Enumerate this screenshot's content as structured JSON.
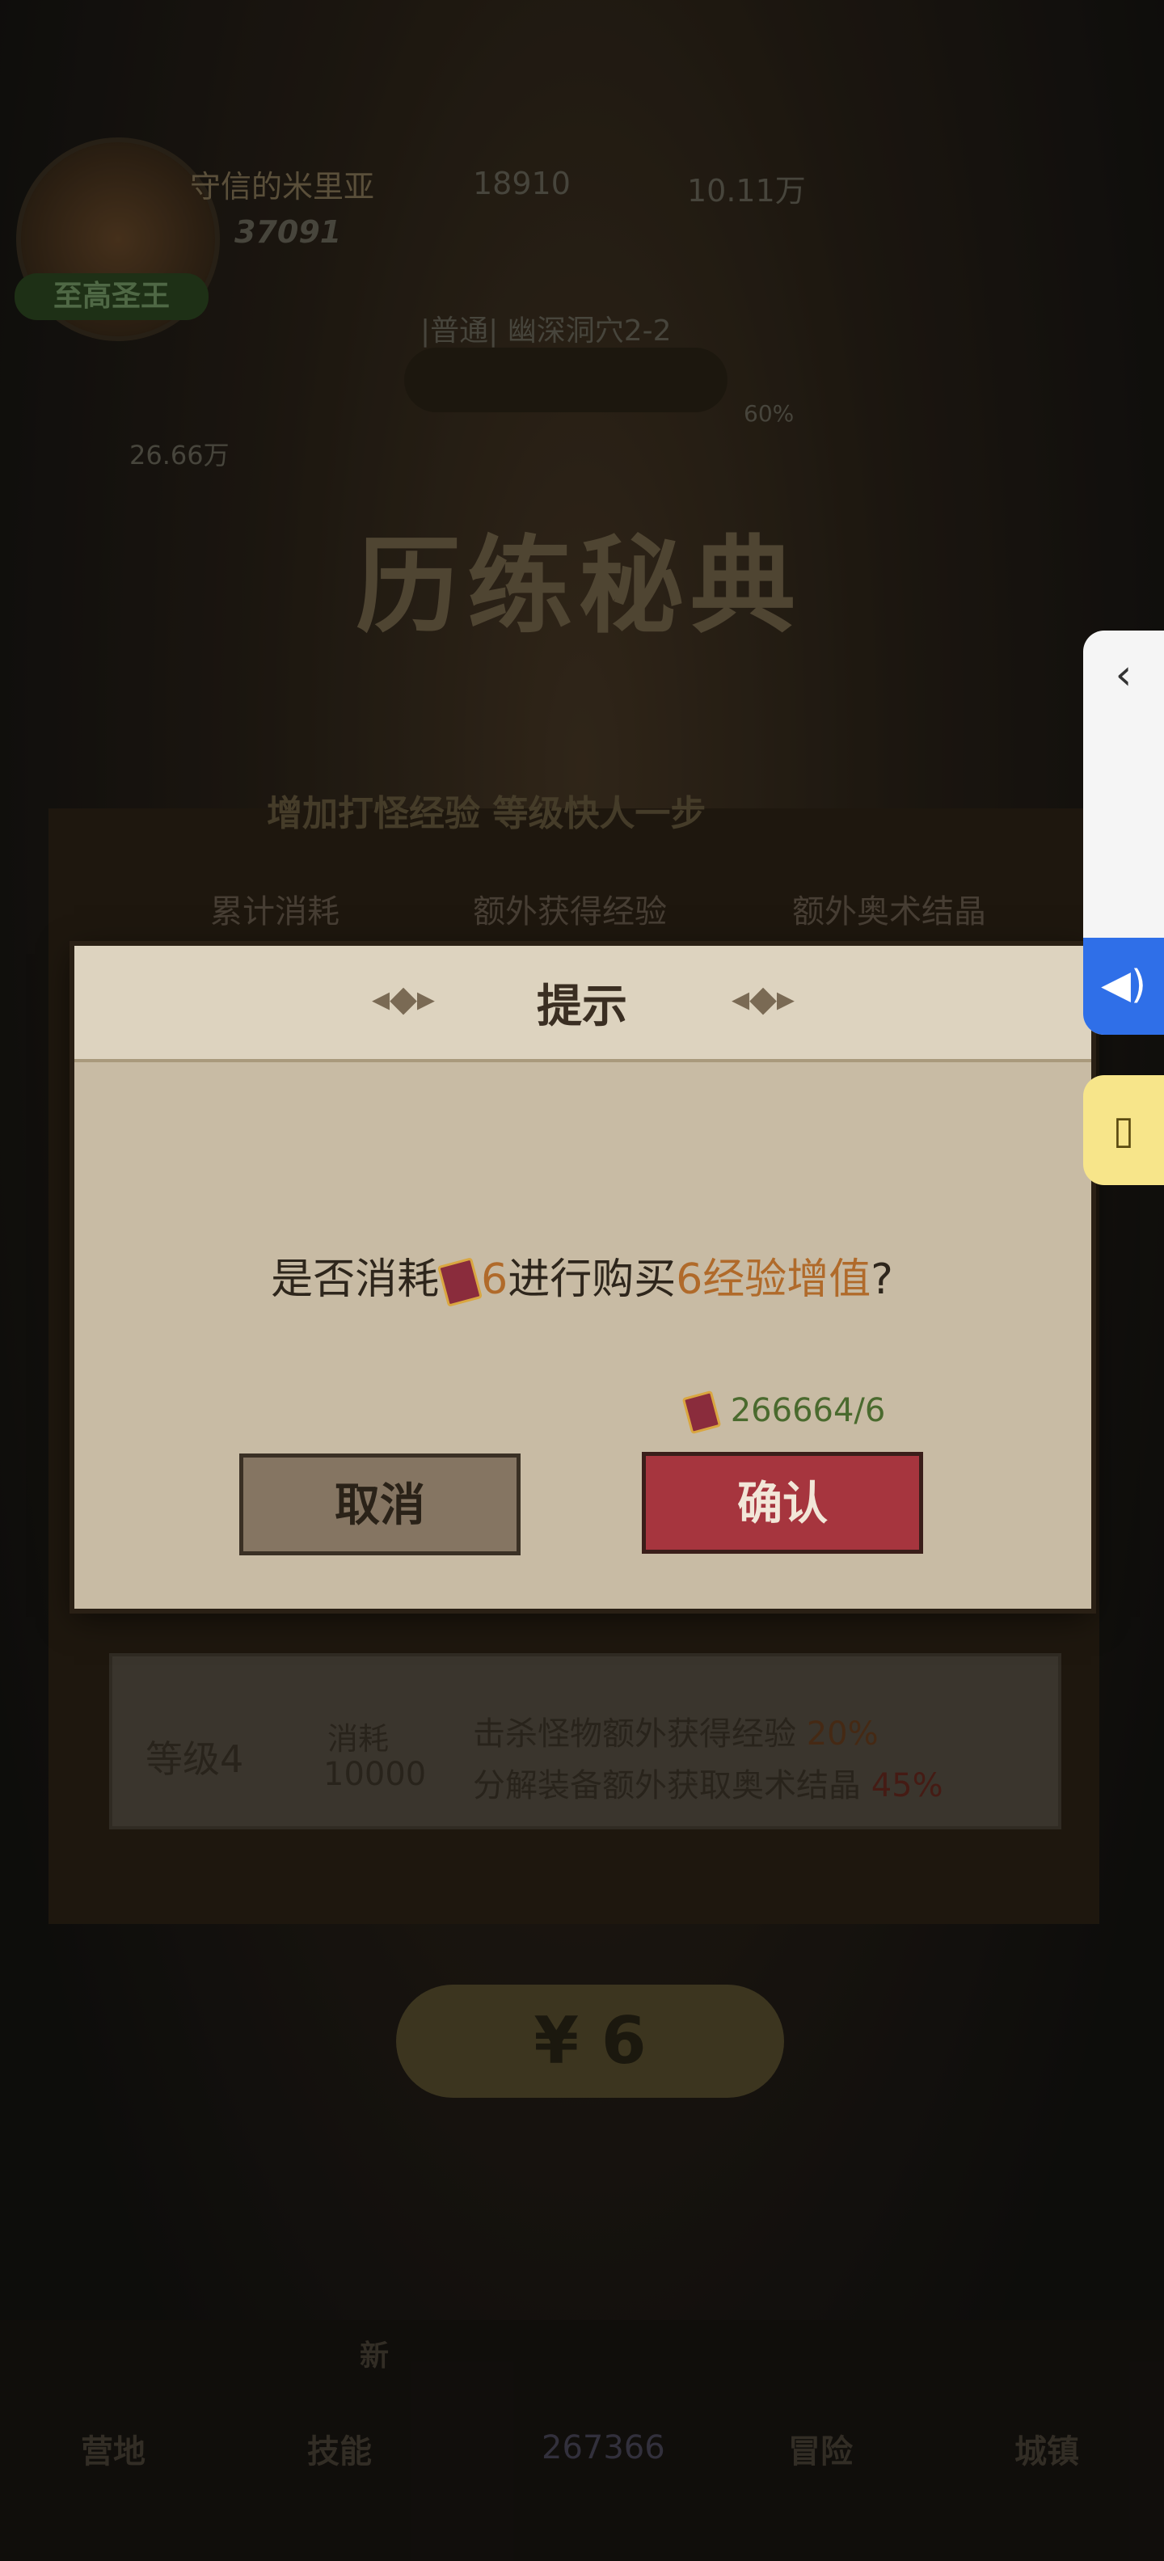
{
  "hud": {
    "player_name": "守信的米里亚",
    "gems": "18910",
    "coins": "10.11万",
    "power": "37091",
    "rank": "至高圣王",
    "stage": "|普通| 幽深洞穴2-2",
    "progress": "60%",
    "tickets": "26.66万"
  },
  "book": {
    "title": "历练秘典",
    "subtitle": "增加打怪经验 等级快人一步",
    "columns": [
      "累计消耗",
      "额外获得经验",
      "额外奥术结晶"
    ],
    "level_row": {
      "level": "等级4",
      "cost_label": "消耗",
      "cost_value": "10000",
      "bonus_exp": "击杀怪物额外获得经验",
      "bonus_exp_pct": "20%",
      "bonus_crystal": "分解装备额外获取奥术结晶",
      "bonus_crystal_pct": "45%"
    },
    "price": "¥ 6"
  },
  "dialog": {
    "title": "提示",
    "message_prefix": "是否消耗",
    "message_amount": "6",
    "message_mid": "进行购买",
    "message_item": "6经验增值",
    "message_suffix": "?",
    "balance": "266664/6",
    "cancel_label": "取消",
    "confirm_label": "确认"
  },
  "bottom_nav": {
    "items": [
      "营地",
      "技能",
      "冒险",
      "城镇"
    ],
    "skills_badge": "新",
    "center_value": "267366"
  },
  "side": {
    "collapse_icon": "chevron-left-icon",
    "sound_icon": "speaker-icon",
    "vibrate_icon": "vibrate-icon"
  }
}
